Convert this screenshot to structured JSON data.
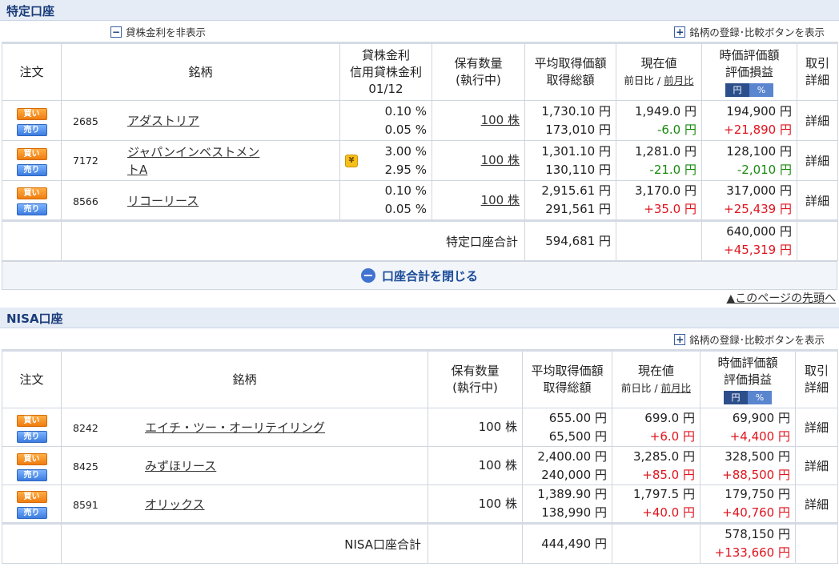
{
  "tokutei": {
    "title": "特定口座",
    "toggle_rate": "貸株金利を非表示",
    "register_btn": "銘柄の登録･比較ボタンを表示",
    "headers": {
      "order": "注文",
      "name": "銘柄",
      "rate1": "貸株金利",
      "rate2": "信用貸株金利",
      "rate3": "01/12",
      "qty1": "保有数量",
      "qty2": "(執行中)",
      "avg1": "平均取得価額",
      "avg2": "取得総額",
      "cur1": "現在値",
      "cur2a": "前日比",
      "cur2b": "前月比",
      "val1": "時価評価額",
      "val2": "評価損益",
      "u_yen": "円",
      "u_pct": "%",
      "det1": "取引",
      "det2": "詳細"
    },
    "rows": [
      {
        "code": "2685",
        "name": "アダストリア",
        "rate1": "0.10 %",
        "rate2": "0.05 %",
        "qty": "100 株",
        "avg": "1,730.10 円",
        "total": "173,010 円",
        "cur": "1,949.0 円",
        "chg": "-6.0 円",
        "val": "194,900 円",
        "pl": "+21,890 円",
        "detail": "詳細"
      },
      {
        "code": "7172",
        "name": "ジャパンインベストメントA",
        "rate1": "3.00 %",
        "rate2": "2.95 %",
        "qty": "100 株",
        "avg": "1,301.10 円",
        "total": "130,110 円",
        "cur": "1,281.0 円",
        "chg": "-21.0 円",
        "val": "128,100 円",
        "pl": "-2,010 円",
        "detail": "詳細"
      },
      {
        "code": "8566",
        "name": "リコーリース",
        "rate1": "0.10 %",
        "rate2": "0.05 %",
        "qty": "100 株",
        "avg": "2,915.61 円",
        "total": "291,561 円",
        "cur": "3,170.0 円",
        "chg": "+35.0 円",
        "val": "317,000 円",
        "pl": "+25,439 円",
        "detail": "詳細"
      }
    ],
    "sum_label": "特定口座合計",
    "sum_total": "594,681 円",
    "sum_val": "640,000 円",
    "sum_pl": "+45,319 円",
    "close": "口座合計を閉じる"
  },
  "buy_label": "買い",
  "sell_label": "売り",
  "page_top": "▲このページの先頭へ",
  "nisa": {
    "title": "NISA口座",
    "register_btn": "銘柄の登録･比較ボタンを表示",
    "rows": [
      {
        "code": "8242",
        "name": "エイチ・ツー・オーリテイリング",
        "qty": "100 株",
        "avg": "655.00 円",
        "total": "65,500 円",
        "cur": "699.0 円",
        "chg": "+6.0 円",
        "val": "69,900 円",
        "pl": "+4,400 円",
        "detail": "詳細"
      },
      {
        "code": "8425",
        "name": "みずほリース",
        "qty": "100 株",
        "avg": "2,400.00 円",
        "total": "240,000 円",
        "cur": "3,285.0 円",
        "chg": "+85.0 円",
        "val": "328,500 円",
        "pl": "+88,500 円",
        "detail": "詳細"
      },
      {
        "code": "8591",
        "name": "オリックス",
        "qty": "100 株",
        "avg": "1,389.90 円",
        "total": "138,990 円",
        "cur": "1,797.5 円",
        "chg": "+40.0 円",
        "val": "179,750 円",
        "pl": "+40,760 円",
        "detail": "詳細"
      }
    ],
    "sum_label": "NISA口座合計",
    "sum_total": "444,490 円",
    "sum_val": "578,150 円",
    "sum_pl": "+133,660 円"
  }
}
